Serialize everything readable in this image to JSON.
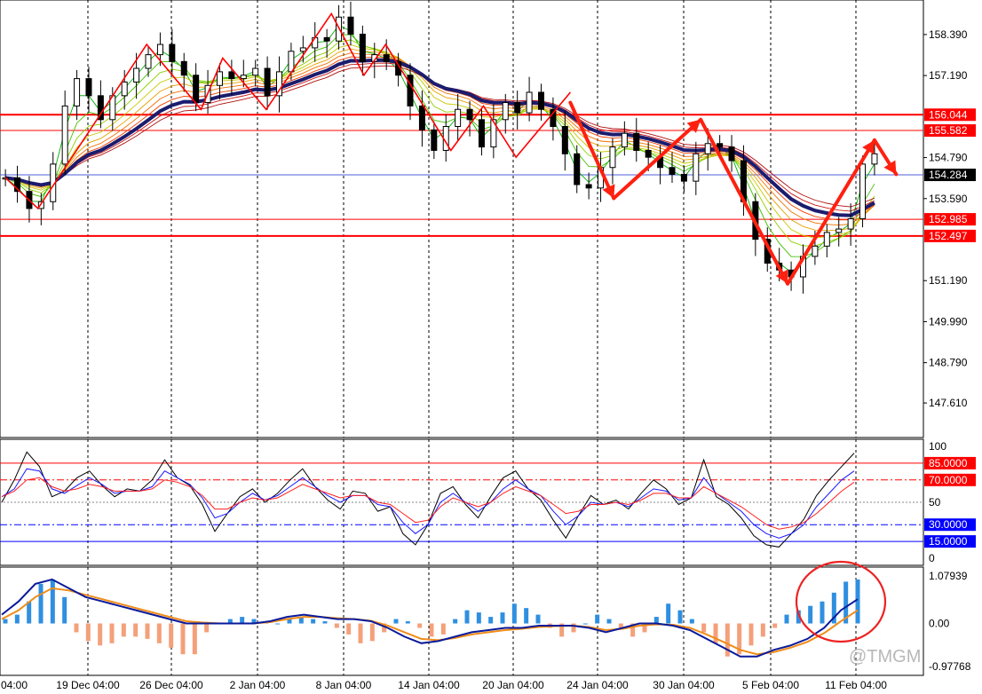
{
  "chart_data": {
    "type": "candlestick",
    "x_tick_labels": [
      "04:00",
      "19 Dec 04:00",
      "26 Dec 04:00",
      "2 Jan 04:00",
      "8 Jan 04:00",
      "14 Jan 04:00",
      "20 Jan 04:00",
      "24 Jan 04:00",
      "30 Jan 04:00",
      "5 Feb 04:00",
      "11 Feb 04:00"
    ],
    "price_panel": {
      "ylim": [
        146.6,
        159.4
      ],
      "y_ticks": [
        "158.390",
        "157.190",
        "156.044",
        "155.582",
        "154.790",
        "154.284",
        "153.590",
        "152.985",
        "152.497",
        "151.190",
        "149.990",
        "148.790",
        "147.610"
      ],
      "series_close": [
        154.2,
        153.8,
        153.3,
        153.5,
        154.6,
        156.3,
        157.1,
        156.6,
        155.9,
        156.6,
        157.0,
        157.4,
        157.8,
        158.1,
        157.6,
        157.2,
        156.4,
        156.9,
        157.3,
        157.1,
        157.2,
        157.4,
        156.6,
        157.3,
        157.9,
        158.0,
        158.3,
        158.2,
        158.9,
        158.4,
        157.6,
        157.8,
        157.6,
        157.2,
        156.3,
        155.6,
        155.0,
        155.7,
        156.2,
        155.9,
        155.1,
        155.9,
        156.4,
        156.1,
        156.7,
        156.2,
        155.7,
        154.9,
        154.0,
        153.9,
        154.5,
        155.1,
        155.5,
        155.0,
        154.8,
        154.5,
        154.3,
        154.1,
        154.9,
        155.2,
        155.1,
        154.7,
        153.5,
        152.4,
        151.7,
        151.5,
        151.3,
        151.9,
        152.2,
        152.6,
        152.7,
        153.0,
        154.6,
        154.9
      ],
      "horizontal_levels": [
        {
          "value": 156.044,
          "label": "156.044",
          "color": "#ff0000"
        },
        {
          "value": 155.582,
          "label": "155.582",
          "color": "#ff0000"
        },
        {
          "value": 154.284,
          "label": "154.284",
          "color": "#000000",
          "line": "#4f5fd8"
        },
        {
          "value": 152.985,
          "label": "152.985",
          "color": "#ff0000"
        },
        {
          "value": 152.497,
          "label": "152.497",
          "color": "#ff0000"
        }
      ],
      "zigzag": [
        {
          "i": 0,
          "v": 154.2
        },
        {
          "i": 3,
          "v": 153.3
        },
        {
          "i": 13,
          "v": 158.1
        },
        {
          "i": 18,
          "v": 156.2
        },
        {
          "i": 20,
          "v": 157.7
        },
        {
          "i": 24,
          "v": 156.2
        },
        {
          "i": 30,
          "v": 159.0
        },
        {
          "i": 33,
          "v": 157.2
        },
        {
          "i": 35,
          "v": 158.1
        },
        {
          "i": 41,
          "v": 155.0
        },
        {
          "i": 44,
          "v": 156.3
        },
        {
          "i": 47,
          "v": 154.8
        },
        {
          "i": 52,
          "v": 156.7
        }
      ],
      "projection_arrows": [
        {
          "from": {
            "i": 52,
            "v": 156.4
          },
          "to": {
            "i": 56,
            "v": 153.6
          }
        },
        {
          "from": {
            "i": 56,
            "v": 153.6
          },
          "to": {
            "i": 64,
            "v": 155.9
          }
        },
        {
          "from": {
            "i": 64,
            "v": 155.9
          },
          "to": {
            "i": 72,
            "v": 151.1
          }
        },
        {
          "from": {
            "i": 72,
            "v": 151.1
          },
          "to": {
            "i": 80,
            "v": 155.3
          }
        },
        {
          "from": {
            "i": 80,
            "v": 155.3
          },
          "to": {
            "i": 82,
            "v": 154.3
          }
        }
      ]
    },
    "stoch_panel": {
      "ylim": [
        0,
        100
      ],
      "y_ticks": [
        "100",
        "50",
        "0"
      ],
      "levels": [
        {
          "value": 85,
          "label": "85.0000",
          "color": "#ff0000"
        },
        {
          "value": 70,
          "label": "70.0000",
          "color": "#ff0000"
        },
        {
          "value": 30,
          "label": "30.0000",
          "color": "#0000ff"
        },
        {
          "value": 15,
          "label": "15.0000",
          "color": "#0000ff"
        }
      ],
      "fast": [
        50,
        70,
        95,
        82,
        55,
        60,
        72,
        78,
        65,
        55,
        62,
        60,
        70,
        88,
        72,
        65,
        48,
        24,
        40,
        55,
        62,
        50,
        58,
        70,
        80,
        64,
        52,
        44,
        60,
        58,
        42,
        46,
        22,
        12,
        30,
        58,
        64,
        48,
        36,
        55,
        72,
        78,
        62,
        52,
        34,
        18,
        38,
        56,
        48,
        52,
        44,
        58,
        70,
        62,
        48,
        54,
        88,
        55,
        48,
        36,
        20,
        12,
        10,
        22,
        35,
        56,
        70,
        82,
        94
      ],
      "signal": [
        55,
        62,
        80,
        78,
        62,
        58,
        65,
        72,
        66,
        58,
        60,
        60,
        64,
        78,
        72,
        66,
        54,
        36,
        40,
        50,
        58,
        52,
        56,
        64,
        72,
        64,
        56,
        50,
        56,
        56,
        48,
        46,
        32,
        22,
        30,
        50,
        58,
        50,
        42,
        50,
        62,
        70,
        62,
        56,
        42,
        30,
        38,
        50,
        48,
        50,
        46,
        54,
        62,
        60,
        52,
        54,
        72,
        58,
        50,
        42,
        30,
        22,
        18,
        22,
        30,
        46,
        58,
        70,
        78
      ],
      "slow": [
        55,
        60,
        70,
        72,
        64,
        60,
        62,
        66,
        64,
        60,
        60,
        60,
        62,
        70,
        68,
        64,
        56,
        44,
        44,
        50,
        54,
        52,
        54,
        60,
        66,
        62,
        58,
        54,
        56,
        56,
        50,
        48,
        40,
        32,
        34,
        46,
        54,
        50,
        46,
        50,
        58,
        64,
        60,
        56,
        48,
        40,
        42,
        48,
        48,
        50,
        48,
        52,
        58,
        58,
        54,
        54,
        64,
        58,
        52,
        46,
        38,
        30,
        26,
        28,
        32,
        40,
        50,
        60,
        68
      ]
    },
    "macd_panel": {
      "ylim": [
        -0.97768,
        1.07939
      ],
      "y_ticks": [
        "1.07939",
        "0.00",
        "-0.97768"
      ],
      "histogram": [
        0.1,
        0.2,
        0.5,
        0.9,
        1.0,
        0.6,
        -0.2,
        -0.4,
        -0.5,
        -0.45,
        -0.3,
        -0.3,
        -0.35,
        -0.45,
        -0.55,
        -0.7,
        -0.7,
        -0.2,
        0,
        0.1,
        0.15,
        0.1,
        0.05,
        0,
        0.1,
        0.15,
        0.1,
        0.05,
        -0.1,
        -0.25,
        -0.45,
        -0.4,
        -0.2,
        0.1,
        0.05,
        -0.1,
        -0.3,
        -0.25,
        0.1,
        0.3,
        0.25,
        0.15,
        0.25,
        0.45,
        0.35,
        0.2,
        -0.1,
        -0.3,
        -0.2,
        0,
        0.2,
        0.1,
        -0.1,
        -0.3,
        -0.2,
        0.15,
        0.45,
        0.3,
        0.1,
        -0.2,
        -0.45,
        -0.75,
        -0.7,
        -0.5,
        -0.3,
        -0.1,
        0.2,
        0.3,
        0.4,
        0.5,
        0.7,
        0.95,
        1.0
      ],
      "macd": [
        0.2,
        0.5,
        0.9,
        1.0,
        0.8,
        0.6,
        0.5,
        0.4,
        0.3,
        0.2,
        0.1,
        0.0,
        0.0,
        0.0,
        0.0,
        0.0,
        0.05,
        0.15,
        0.2,
        0.15,
        0.1,
        0.1,
        0.05,
        -0.1,
        -0.3,
        -0.45,
        -0.4,
        -0.3,
        -0.2,
        -0.15,
        -0.1,
        -0.1,
        -0.05,
        -0.05,
        -0.05,
        -0.1,
        -0.2,
        -0.1,
        0.0,
        0.0,
        -0.05,
        -0.15,
        -0.35,
        -0.55,
        -0.75,
        -0.75,
        -0.6,
        -0.5,
        -0.35,
        -0.1,
        0.3,
        0.55
      ],
      "signal": [
        0.1,
        0.3,
        0.6,
        0.8,
        0.75,
        0.65,
        0.55,
        0.45,
        0.35,
        0.25,
        0.15,
        0.05,
        0.02,
        0.0,
        0.0,
        0.0,
        0.03,
        0.1,
        0.15,
        0.15,
        0.12,
        0.1,
        0.06,
        -0.05,
        -0.2,
        -0.35,
        -0.38,
        -0.33,
        -0.25,
        -0.2,
        -0.15,
        -0.12,
        -0.08,
        -0.06,
        -0.05,
        -0.08,
        -0.15,
        -0.12,
        -0.05,
        -0.02,
        -0.03,
        -0.1,
        -0.25,
        -0.42,
        -0.6,
        -0.7,
        -0.65,
        -0.55,
        -0.42,
        -0.22,
        0.05,
        0.3
      ]
    }
  },
  "watermark": "@TMGM"
}
